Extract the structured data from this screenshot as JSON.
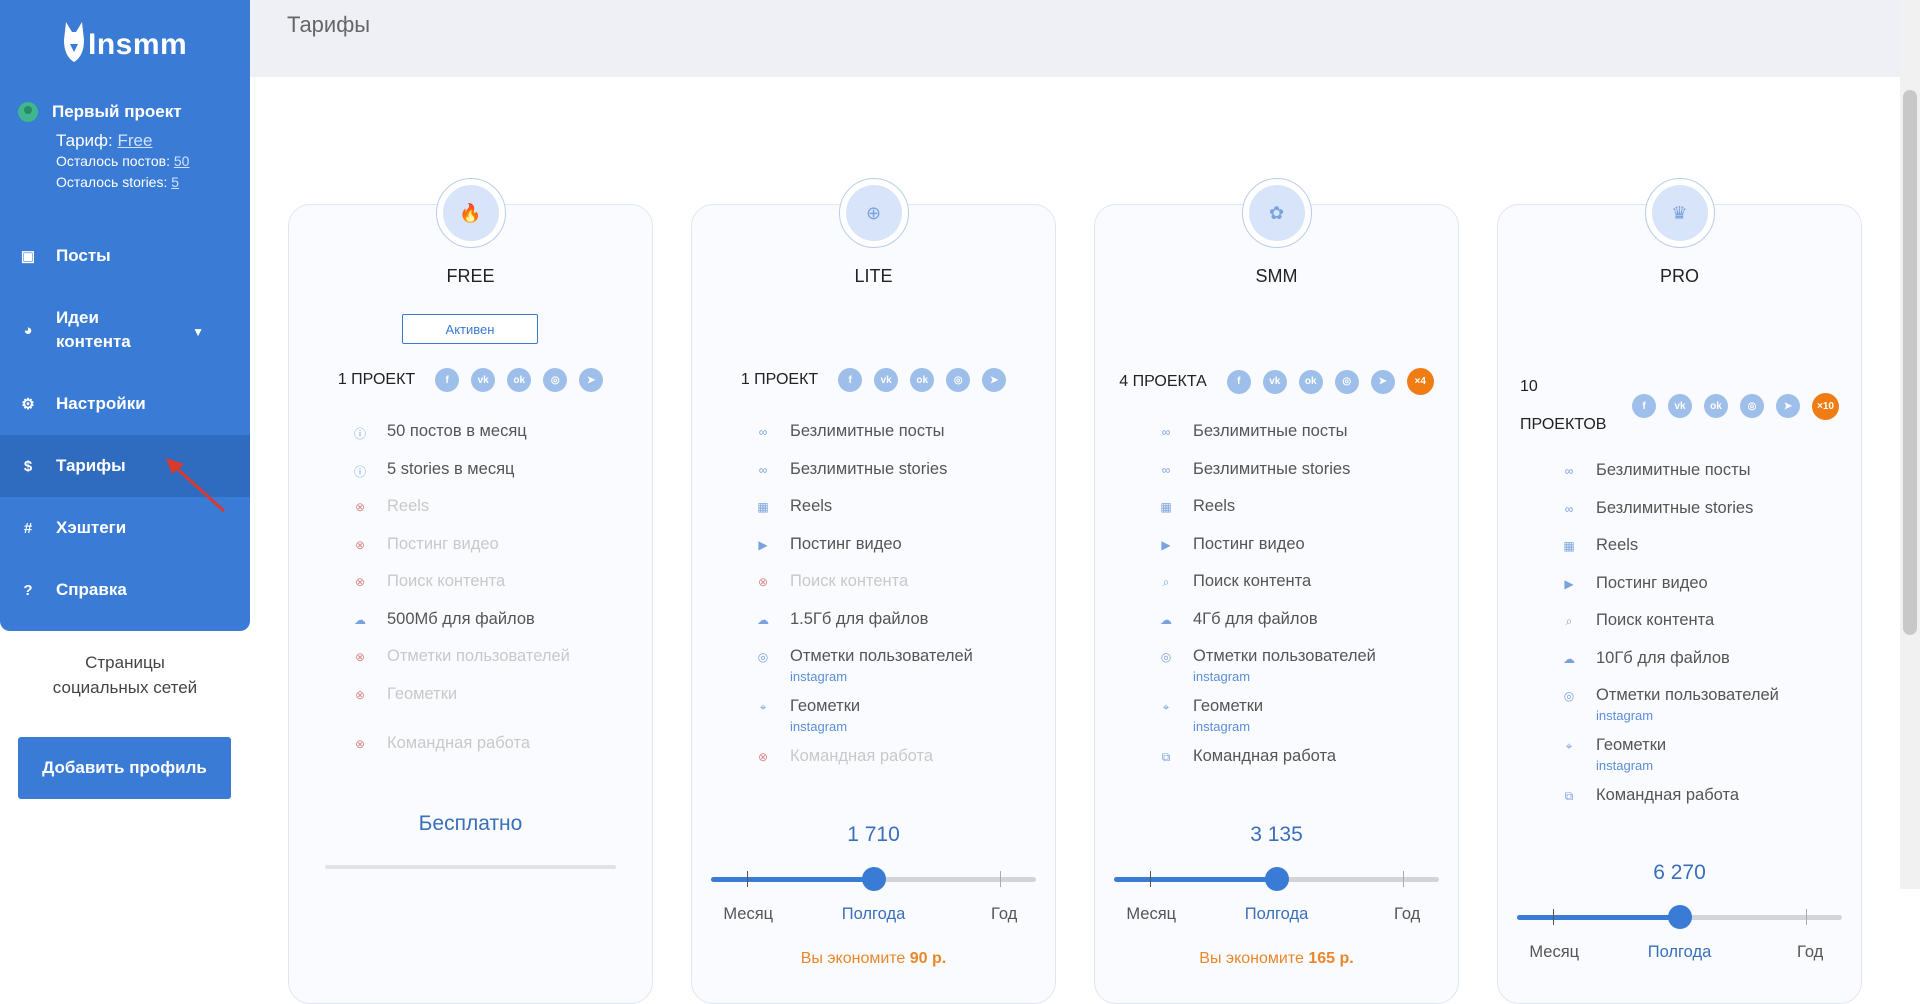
{
  "app": {
    "logo_text": "Insmm",
    "page_title": "Тарифы"
  },
  "project": {
    "name": "Первый проект",
    "tariff_label": "Тариф:",
    "tariff_value": "Free",
    "posts_left_label": "Осталось постов:",
    "posts_left_value": "50",
    "stories_left_label": "Осталось stories:",
    "stories_left_value": "5"
  },
  "nav": {
    "posts": "Посты",
    "ideas": "Идеи контента",
    "settings": "Настройки",
    "tariffs": "Тарифы",
    "hashtags": "Хэштеги",
    "help": "Справка"
  },
  "social_pages": "Страницы социальных сетей",
  "add_profile": "Добавить профиль",
  "social_icons": [
    "f",
    "vk",
    "ok",
    "ig",
    "tg"
  ],
  "colors": {
    "accent": "#3a7bd5",
    "accent_dark": "#2f6bbf",
    "orange": "#f07c14"
  },
  "plans": [
    {
      "title": "FREE",
      "active_label": "Активен",
      "projects": "1 ПРОЕКТ",
      "features": [
        {
          "icon": "info-icon",
          "text": "50 постов в месяц",
          "on": true
        },
        {
          "icon": "info-icon",
          "text": "5 stories в месяц",
          "on": true
        },
        {
          "icon": "cross-icon",
          "text": "Reels",
          "on": false
        },
        {
          "icon": "cross-icon",
          "text": "Постинг видео",
          "on": false
        },
        {
          "icon": "cross-icon",
          "text": "Поиск контента",
          "on": false
        },
        {
          "icon": "cloud-icon",
          "text": "500Мб для файлов",
          "on": true
        },
        {
          "icon": "cross-icon",
          "text": "Отметки пользователей",
          "on": false
        },
        {
          "icon": "cross-icon",
          "text": "Геометки",
          "on": false
        },
        {
          "icon": "cross-icon",
          "text": "Командная работа",
          "on": false
        }
      ],
      "price": "Бесплатно"
    },
    {
      "title": "LITE",
      "projects": "1 ПРОЕКТ",
      "features": [
        {
          "text": "Безлимитные посты",
          "on": true
        },
        {
          "text": "Безлимитные stories",
          "on": true
        },
        {
          "text": "Reels",
          "on": true
        },
        {
          "text": "Постинг видео",
          "on": true
        },
        {
          "text": "Поиск контента",
          "on": false
        },
        {
          "text": "1.5Гб для файлов",
          "on": true
        },
        {
          "text": "Отметки пользователей",
          "sub": "instagram",
          "on": true
        },
        {
          "text": "Геометки",
          "sub": "instagram",
          "on": true
        },
        {
          "text": "Командная работа",
          "on": false
        }
      ],
      "price": "1 710",
      "period_value": 0.5,
      "periods": [
        "Месяц",
        "Полгода",
        "Год"
      ],
      "selected_period": "Полгода",
      "saving_label": "Вы экономите",
      "saving_value": "90 р."
    },
    {
      "title": "SMM",
      "projects": "4 ПРОЕКТА",
      "multiplier": "×4",
      "features": [
        {
          "text": "Безлимитные посты",
          "on": true
        },
        {
          "text": "Безлимитные stories",
          "on": true
        },
        {
          "text": "Reels",
          "on": true
        },
        {
          "text": "Постинг видео",
          "on": true
        },
        {
          "text": "Поиск контента",
          "on": true
        },
        {
          "text": "4Гб для файлов",
          "on": true
        },
        {
          "text": "Отметки пользователей",
          "sub": "instagram",
          "on": true
        },
        {
          "text": "Геометки",
          "sub": "instagram",
          "on": true
        },
        {
          "text": "Командная работа",
          "on": true
        }
      ],
      "price": "3 135",
      "period_value": 0.5,
      "periods": [
        "Месяц",
        "Полгода",
        "Год"
      ],
      "selected_period": "Полгода",
      "saving_label": "Вы экономите",
      "saving_value": "165 р."
    },
    {
      "title": "PRO",
      "projects": "10 ПРОЕКТОВ",
      "multiplier": "×10",
      "features": [
        {
          "text": "Безлимитные посты",
          "on": true
        },
        {
          "text": "Безлимитные stories",
          "on": true
        },
        {
          "text": "Reels",
          "on": true
        },
        {
          "text": "Постинг видео",
          "on": true
        },
        {
          "text": "Поиск контента",
          "on": true
        },
        {
          "text": "10Гб для файлов",
          "on": true
        },
        {
          "text": "Отметки пользователей",
          "sub": "instagram",
          "on": true
        },
        {
          "text": "Геометки",
          "sub": "instagram",
          "on": true
        },
        {
          "text": "Командная работа",
          "on": true
        }
      ],
      "price": "6 270",
      "period_value": 0.5,
      "periods": [
        "Месяц",
        "Полгода",
        "Год"
      ],
      "selected_period": "Полгода"
    }
  ]
}
